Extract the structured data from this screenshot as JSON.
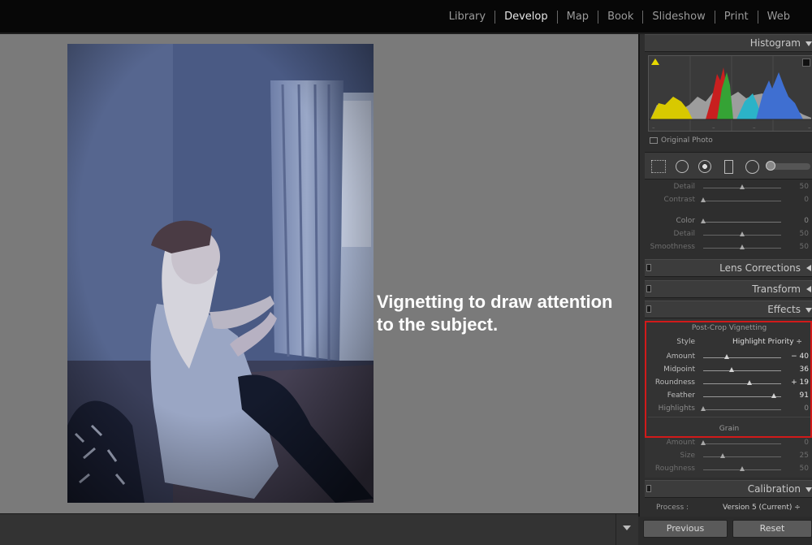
{
  "topbar": {
    "modules": [
      {
        "label": "Library",
        "active": false
      },
      {
        "label": "Develop",
        "active": true
      },
      {
        "label": "Map",
        "active": false
      },
      {
        "label": "Book",
        "active": false
      },
      {
        "label": "Slideshow",
        "active": false
      },
      {
        "label": "Print",
        "active": false
      },
      {
        "label": "Web",
        "active": false
      }
    ]
  },
  "caption": {
    "line1": "Vignetting to draw attention",
    "line2": "to the subject."
  },
  "histogram": {
    "title": "Histogram",
    "original_photo_label": "Original Photo"
  },
  "toolstrip": {
    "icons": [
      "crop-overlay-icon",
      "spot-removal-icon",
      "red-eye-icon",
      "graduated-filter-icon",
      "radial-filter-icon",
      "adjustment-brush-icon"
    ]
  },
  "detail_top": [
    {
      "label": "Detail",
      "value": "50",
      "fraction": 0.5
    },
    {
      "label": "Contrast",
      "value": "0",
      "fraction": 0.0
    }
  ],
  "color_nr": [
    {
      "label": "Color",
      "value": "0",
      "fraction": 0.0
    },
    {
      "label": "Detail",
      "value": "50",
      "fraction": 0.5
    },
    {
      "label": "Smoothness",
      "value": "50",
      "fraction": 0.5
    }
  ],
  "panels": {
    "lens_corrections": "Lens Corrections",
    "transform": "Transform",
    "effects": "Effects",
    "calibration": "Calibration"
  },
  "effects": {
    "post_crop_title": "Post-Crop Vignetting",
    "style_label": "Style",
    "style_value": "Highlight Priority ÷",
    "vignette": [
      {
        "label": "Amount",
        "value": "− 40",
        "fraction": 0.3
      },
      {
        "label": "Midpoint",
        "value": "36",
        "fraction": 0.36
      },
      {
        "label": "Roundness",
        "value": "+ 19",
        "fraction": 0.595
      },
      {
        "label": "Feather",
        "value": "91",
        "fraction": 0.91
      },
      {
        "label": "Highlights",
        "value": "0",
        "fraction": 0.0
      }
    ],
    "grain_title": "Grain",
    "grain": [
      {
        "label": "Amount",
        "value": "0",
        "fraction": 0.0
      },
      {
        "label": "Size",
        "value": "25",
        "fraction": 0.25
      },
      {
        "label": "Roughness",
        "value": "50",
        "fraction": 0.5
      }
    ]
  },
  "calibration": {
    "process_label": "Process :",
    "process_value": "Version 5 (Current) ÷"
  },
  "buttons": {
    "previous": "Previous",
    "reset": "Reset"
  },
  "colors": {
    "highlight_box": "#d11a1a",
    "canvas": "#7a7a7a"
  }
}
